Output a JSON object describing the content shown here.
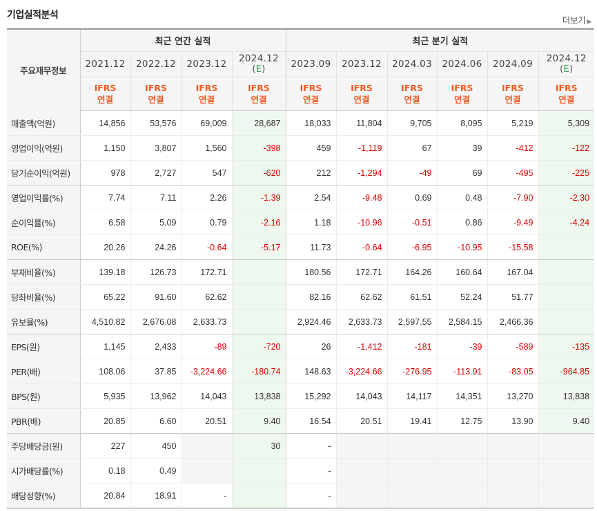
{
  "header": {
    "title": "기업실적분석",
    "more_label": "더보기"
  },
  "table": {
    "label_header": "주요재무정보",
    "group_annual": "최근 연간 실적",
    "group_quarter": "최근 분기 실적",
    "periods": [
      {
        "date": "2021.12",
        "est": "",
        "std1": "IFRS",
        "std2": "연결"
      },
      {
        "date": "2022.12",
        "est": "",
        "std1": "IFRS",
        "std2": "연결"
      },
      {
        "date": "2023.12",
        "est": "",
        "std1": "IFRS",
        "std2": "연결"
      },
      {
        "date": "2024.12",
        "est": "(E)",
        "std1": "IFRS",
        "std2": "연결"
      },
      {
        "date": "2023.09",
        "est": "",
        "std1": "IFRS",
        "std2": "연결"
      },
      {
        "date": "2023.12",
        "est": "",
        "std1": "IFRS",
        "std2": "연결"
      },
      {
        "date": "2024.03",
        "est": "",
        "std1": "IFRS",
        "std2": "연결"
      },
      {
        "date": "2024.06",
        "est": "",
        "std1": "IFRS",
        "std2": "연결"
      },
      {
        "date": "2024.09",
        "est": "",
        "std1": "IFRS",
        "std2": "연결"
      },
      {
        "date": "2024.12",
        "est": "(E)",
        "std1": "IFRS",
        "std2": "연결"
      }
    ],
    "rows": [
      {
        "label": "매출액(억원)",
        "values": [
          "14,856",
          "53,576",
          "69,009",
          "28,687",
          "18,033",
          "11,804",
          "9,705",
          "8,095",
          "5,219",
          "5,309"
        ]
      },
      {
        "label": "영업이익(억원)",
        "values": [
          "1,150",
          "3,807",
          "1,560",
          "-398",
          "459",
          "-1,119",
          "67",
          "39",
          "-412",
          "-122"
        ]
      },
      {
        "label": "당기순이익(억원)",
        "values": [
          "978",
          "2,727",
          "547",
          "-620",
          "212",
          "-1,294",
          "-49",
          "69",
          "-495",
          "-225"
        ]
      },
      {
        "label": "영업이익률(%)",
        "values": [
          "7.74",
          "7.11",
          "2.26",
          "-1.39",
          "2.54",
          "-9.48",
          "0.69",
          "0.48",
          "-7.90",
          "-2.30"
        ]
      },
      {
        "label": "순이익률(%)",
        "values": [
          "6.58",
          "5.09",
          "0.79",
          "-2.16",
          "1.18",
          "-10.96",
          "-0.51",
          "0.86",
          "-9.49",
          "-4.24"
        ]
      },
      {
        "label": "ROE(%)",
        "values": [
          "20.26",
          "24.26",
          "-0.64",
          "-5.17",
          "11.73",
          "-0.64",
          "-6.95",
          "-10.95",
          "-15.58",
          ""
        ]
      },
      {
        "label": "부채비율(%)",
        "values": [
          "139.18",
          "126.73",
          "172.71",
          "",
          "180.56",
          "172.71",
          "164.26",
          "160.64",
          "167.04",
          ""
        ]
      },
      {
        "label": "당좌비율(%)",
        "values": [
          "65.22",
          "91.60",
          "62.62",
          "",
          "82.16",
          "62.62",
          "61.51",
          "52.24",
          "51.77",
          ""
        ]
      },
      {
        "label": "유보율(%)",
        "values": [
          "4,510.82",
          "2,676.08",
          "2,633.73",
          "",
          "2,924.46",
          "2,633.73",
          "2,597.55",
          "2,584.15",
          "2,466.36",
          ""
        ]
      },
      {
        "label": "EPS(원)",
        "values": [
          "1,145",
          "2,433",
          "-89",
          "-720",
          "26",
          "-1,412",
          "-181",
          "-39",
          "-589",
          "-135"
        ]
      },
      {
        "label": "PER(배)",
        "values": [
          "108.06",
          "37.85",
          "-3,224.66",
          "-180.74",
          "148.63",
          "-3,224.66",
          "-276.95",
          "-113.91",
          "-83.05",
          "-964.85"
        ]
      },
      {
        "label": "BPS(원)",
        "values": [
          "5,935",
          "13,962",
          "14,043",
          "13,838",
          "15,292",
          "14,043",
          "14,117",
          "14,351",
          "13,270",
          "13,838"
        ]
      },
      {
        "label": "PBR(배)",
        "values": [
          "20.85",
          "6.60",
          "20.51",
          "9.40",
          "16.54",
          "20.51",
          "19.41",
          "12.75",
          "13.90",
          "9.40"
        ]
      },
      {
        "label": "주당배당금(원)",
        "values": [
          "227",
          "450",
          "",
          "30",
          "-",
          "",
          "",
          "",
          "",
          ""
        ]
      },
      {
        "label": "시가배당률(%)",
        "values": [
          "0.18",
          "0.49",
          "",
          "",
          "-",
          "",
          "",
          "",
          "",
          ""
        ]
      },
      {
        "label": "배당성향(%)",
        "values": [
          "20.84",
          "18.91",
          "-",
          "",
          "-",
          "",
          "",
          "",
          "",
          ""
        ]
      }
    ],
    "group_end_rows": [
      2,
      5,
      8,
      12
    ],
    "gray_cells": {
      "13": [
        2,
        5,
        6,
        7,
        8,
        9
      ],
      "14": [
        2,
        5,
        6,
        7,
        8,
        9
      ],
      "15": [
        5,
        6,
        7,
        8,
        9
      ]
    },
    "estimate_columns": [
      3,
      9
    ],
    "colors": {
      "negative": "#dd0000",
      "ifrs": "#f15a22",
      "estimate_bg": "#eef8ee",
      "header_bg": "#f5f5f5",
      "estimate_e": "#2a9a44"
    }
  }
}
